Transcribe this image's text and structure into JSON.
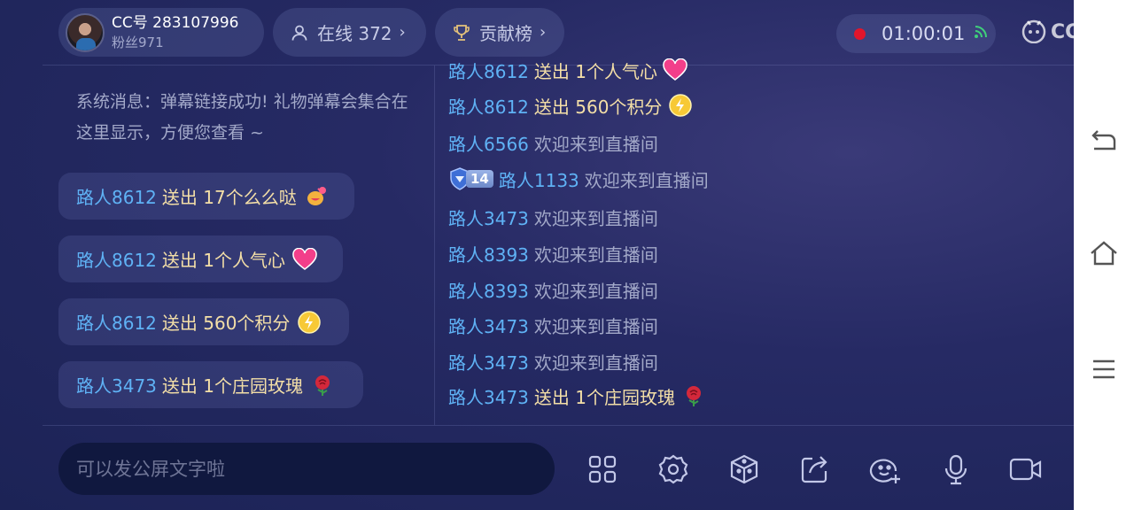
{
  "header": {
    "cc_id": "CC号 283107996",
    "fans": "粉丝971",
    "online_label": "在线 372",
    "rank_label": "贡献榜",
    "timer": "01:00:01",
    "logo_text": "CC直播"
  },
  "system_message": "系统消息：弹幕链接成功! 礼物弹幕会集合在这里显示，方便您查看 ~",
  "gift_bubbles": [
    {
      "user": "路人8612",
      "action": "送出 17个么么哒",
      "icon": "kiss-gift-icon"
    },
    {
      "user": "路人8612",
      "action": "送出 1个人气心",
      "icon": "heart-gift-icon"
    },
    {
      "user": "路人8612",
      "action": "送出 560个积分",
      "icon": "lightning-coin-icon"
    },
    {
      "user": "路人3473",
      "action": "送出 1个庄园玫瑰",
      "icon": "rose-gift-icon"
    }
  ],
  "feed": [
    {
      "user": "路人8612",
      "text": "送出 1个人气心",
      "kind": "gift",
      "icon": "heart-gift-icon"
    },
    {
      "user": "路人8612",
      "text": "送出 560个积分",
      "kind": "gift",
      "icon": "lightning-coin-icon"
    },
    {
      "user": "路人6566",
      "text": "欢迎来到直播间",
      "kind": "welcome"
    },
    {
      "user": "路人1133",
      "text": "欢迎来到直播间",
      "kind": "welcome",
      "badge": "14"
    },
    {
      "user": "路人3473",
      "text": "欢迎来到直播间",
      "kind": "welcome"
    },
    {
      "user": "路人8393",
      "text": "欢迎来到直播间",
      "kind": "welcome"
    },
    {
      "user": "路人8393",
      "text": "欢迎来到直播间",
      "kind": "welcome"
    },
    {
      "user": "路人3473",
      "text": "欢迎来到直播间",
      "kind": "welcome"
    },
    {
      "user": "路人3473",
      "text": "欢迎来到直播间",
      "kind": "welcome"
    },
    {
      "user": "路人3473",
      "text": "送出 1个庄园玫瑰",
      "kind": "gift",
      "icon": "rose-gift-icon"
    }
  ],
  "input": {
    "placeholder": "可以发公屏文字啦",
    "value": ""
  },
  "toolbar": [
    "grid-apps-icon",
    "settings-gear-icon",
    "gift-box-icon",
    "share-icon",
    "emoji-add-icon",
    "microphone-icon",
    "camera-icon"
  ],
  "android_nav": [
    "back-icon",
    "home-icon",
    "menu-icon"
  ],
  "colors": {
    "username": "#5fb2f5",
    "gift_text": "#f4dfa7",
    "welcome_text": "#a3a9c9",
    "record_dot": "#e3152b"
  }
}
